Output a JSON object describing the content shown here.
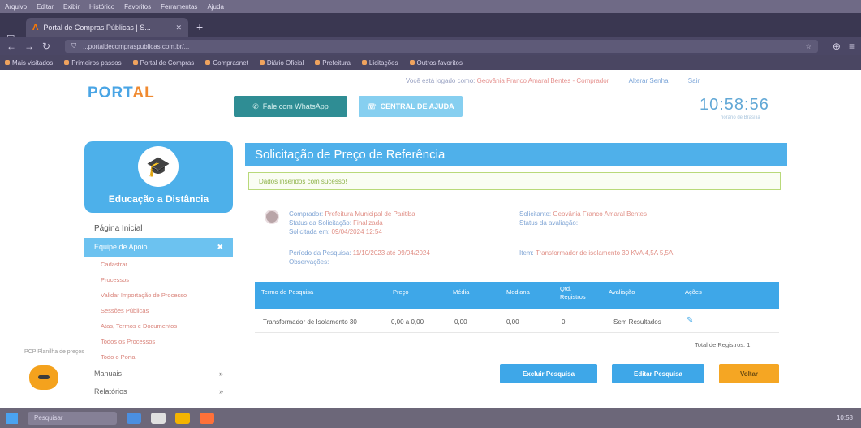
{
  "browser": {
    "menu": [
      "Arquivo",
      "Editar",
      "Exibir",
      "Histórico",
      "Favoritos",
      "Ferramentas",
      "Ajuda"
    ],
    "tab_title": "Portal de Compras Públicas | S...",
    "url": "...portaldecompraspublicas.com.br/...",
    "bookmarks": [
      "Mais visitados",
      "Primeiros passos",
      "Portal de Compras",
      "Comprasnet",
      "Diário Oficial",
      "Prefeitura",
      "Licitações",
      "Outros favoritos"
    ]
  },
  "header": {
    "logo_main": "PORT",
    "logo_accent": "AL",
    "user_prefix": "Você está logado como:",
    "user_name": "Geovânia Franco Amaral Bentes - Comprador",
    "change_password": "Alterar Senha",
    "logout": "Sair",
    "clock": "10:58:56",
    "clock_sub": "horário de Brasília",
    "whatsapp_button": "Fale com WhatsApp",
    "help_button": "CENTRAL DE AJUDA"
  },
  "sidebar": {
    "edu_title": "Educação a Distância",
    "home": "Página Inicial",
    "active_section": "Equipe de Apoio",
    "submenu": [
      "Cadastrar",
      "Processos",
      "Validar Importação de Processo",
      "Sessões Públicas",
      "Atas, Termos e Documentos",
      "Todos os Processos",
      "Todo o Portal"
    ],
    "sections": [
      "Manuais",
      "Relatórios"
    ],
    "float_note": "PCP Planilha de preços"
  },
  "main": {
    "title": "Solicitação de Preço de Referência",
    "alert": "Dados inseridos com sucesso!",
    "comprador_label": "Comprador:",
    "comprador_value": "Prefeitura Municipal de Paritiba",
    "status_label": "Status da Solicitação:",
    "status_value": "Finalizada",
    "solicitada_label": "Solicitada em:",
    "solicitada_value": "09/04/2024 12:54",
    "solicitante_label": "Solicitante:",
    "solicitante_value": "Geovânia Franco Amaral Bentes",
    "status_avaliacao_label": "Status da avaliação:",
    "periodo_label": "Período da Pesquisa:",
    "periodo_value": "11/10/2023 até 09/04/2024",
    "observacoes_label": "Observações:",
    "item_label": "Item:",
    "item_value": "Transformador de isolamento 30 KVA 4,5A 5,5A",
    "table": {
      "headers": [
        "Termo de Pesquisa",
        "Preço",
        "Média",
        "Mediana",
        "Qtd. Registros",
        "Avaliação",
        "Ações"
      ],
      "rows": [
        {
          "termo": "Transformador de Isolamento 30",
          "preco": "0,00 a 0,00",
          "media": "0,00",
          "mediana": "0,00",
          "qtd": "0",
          "avaliacao": "Sem Resultados"
        }
      ],
      "total": "Total de Registros: 1"
    },
    "buttons": {
      "excluir": "Excluir Pesquisa",
      "editar": "Editar Pesquisa",
      "voltar": "Voltar"
    }
  },
  "taskbar": {
    "search": "Pesquisar",
    "time": "10:58"
  },
  "colors": {
    "primary_blue": "#4fb0ea",
    "orange": "#f5a623",
    "whatsapp": "#2f8d94"
  }
}
